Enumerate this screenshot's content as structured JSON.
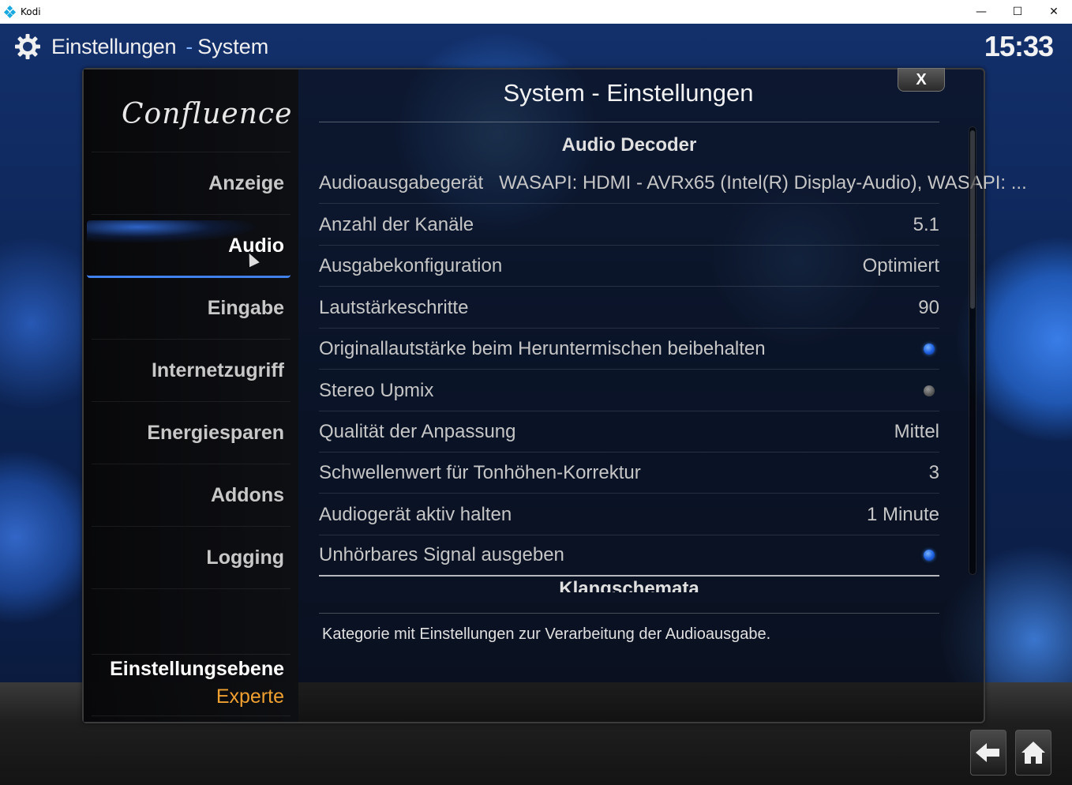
{
  "window": {
    "title": "Kodi",
    "minimize": "—",
    "maximize": "☐",
    "close": "✕"
  },
  "header": {
    "title": "Einstellungen",
    "separator": "-",
    "subtitle": "System",
    "clock": "15:33"
  },
  "sidebar": {
    "logo": "Confluence",
    "items": [
      {
        "label": "Anzeige"
      },
      {
        "label": "Audio"
      },
      {
        "label": "Eingabe"
      },
      {
        "label": "Internetzugriff"
      },
      {
        "label": "Energiesparen"
      },
      {
        "label": "Addons"
      },
      {
        "label": "Logging"
      }
    ],
    "active_item": "Audio",
    "level_label": "Einstellungsebene",
    "level_value": "Experte"
  },
  "content": {
    "title": "System - Einstellungen",
    "close_label": "X",
    "section": "Audio Decoder",
    "next_section": "Klangschemata",
    "settings": [
      {
        "label": "Audioausgabegerät",
        "value": "WASAPI: HDMI - AVRx65 (Intel(R) Display-Audio), WASAPI: ..."
      },
      {
        "label": "Anzahl der Kanäle",
        "value": "5.1"
      },
      {
        "label": "Ausgabekonfiguration",
        "value": "Optimiert"
      },
      {
        "label": "Lautstärkeschritte",
        "value": "90"
      },
      {
        "label": "Originallautstärke beim Heruntermischen beibehalten",
        "toggle": true
      },
      {
        "label": "Stereo Upmix",
        "toggle": false
      },
      {
        "label": "Qualität der Anpassung",
        "value": "Mittel"
      },
      {
        "label": "Schwellenwert für Tonhöhen-Korrektur",
        "value": "3"
      },
      {
        "label": "Audiogerät aktiv halten",
        "value": "1 Minute"
      },
      {
        "label": "Unhörbares Signal ausgeben",
        "toggle": true
      }
    ],
    "description": "Kategorie mit Einstellungen zur Verarbeitung der Audioausgabe."
  },
  "icons": {
    "gear": "gear-icon",
    "back": "back-arrow-icon",
    "home": "home-icon"
  },
  "colors": {
    "accent": "#1c5ee0",
    "level_value": "#f0a030"
  }
}
